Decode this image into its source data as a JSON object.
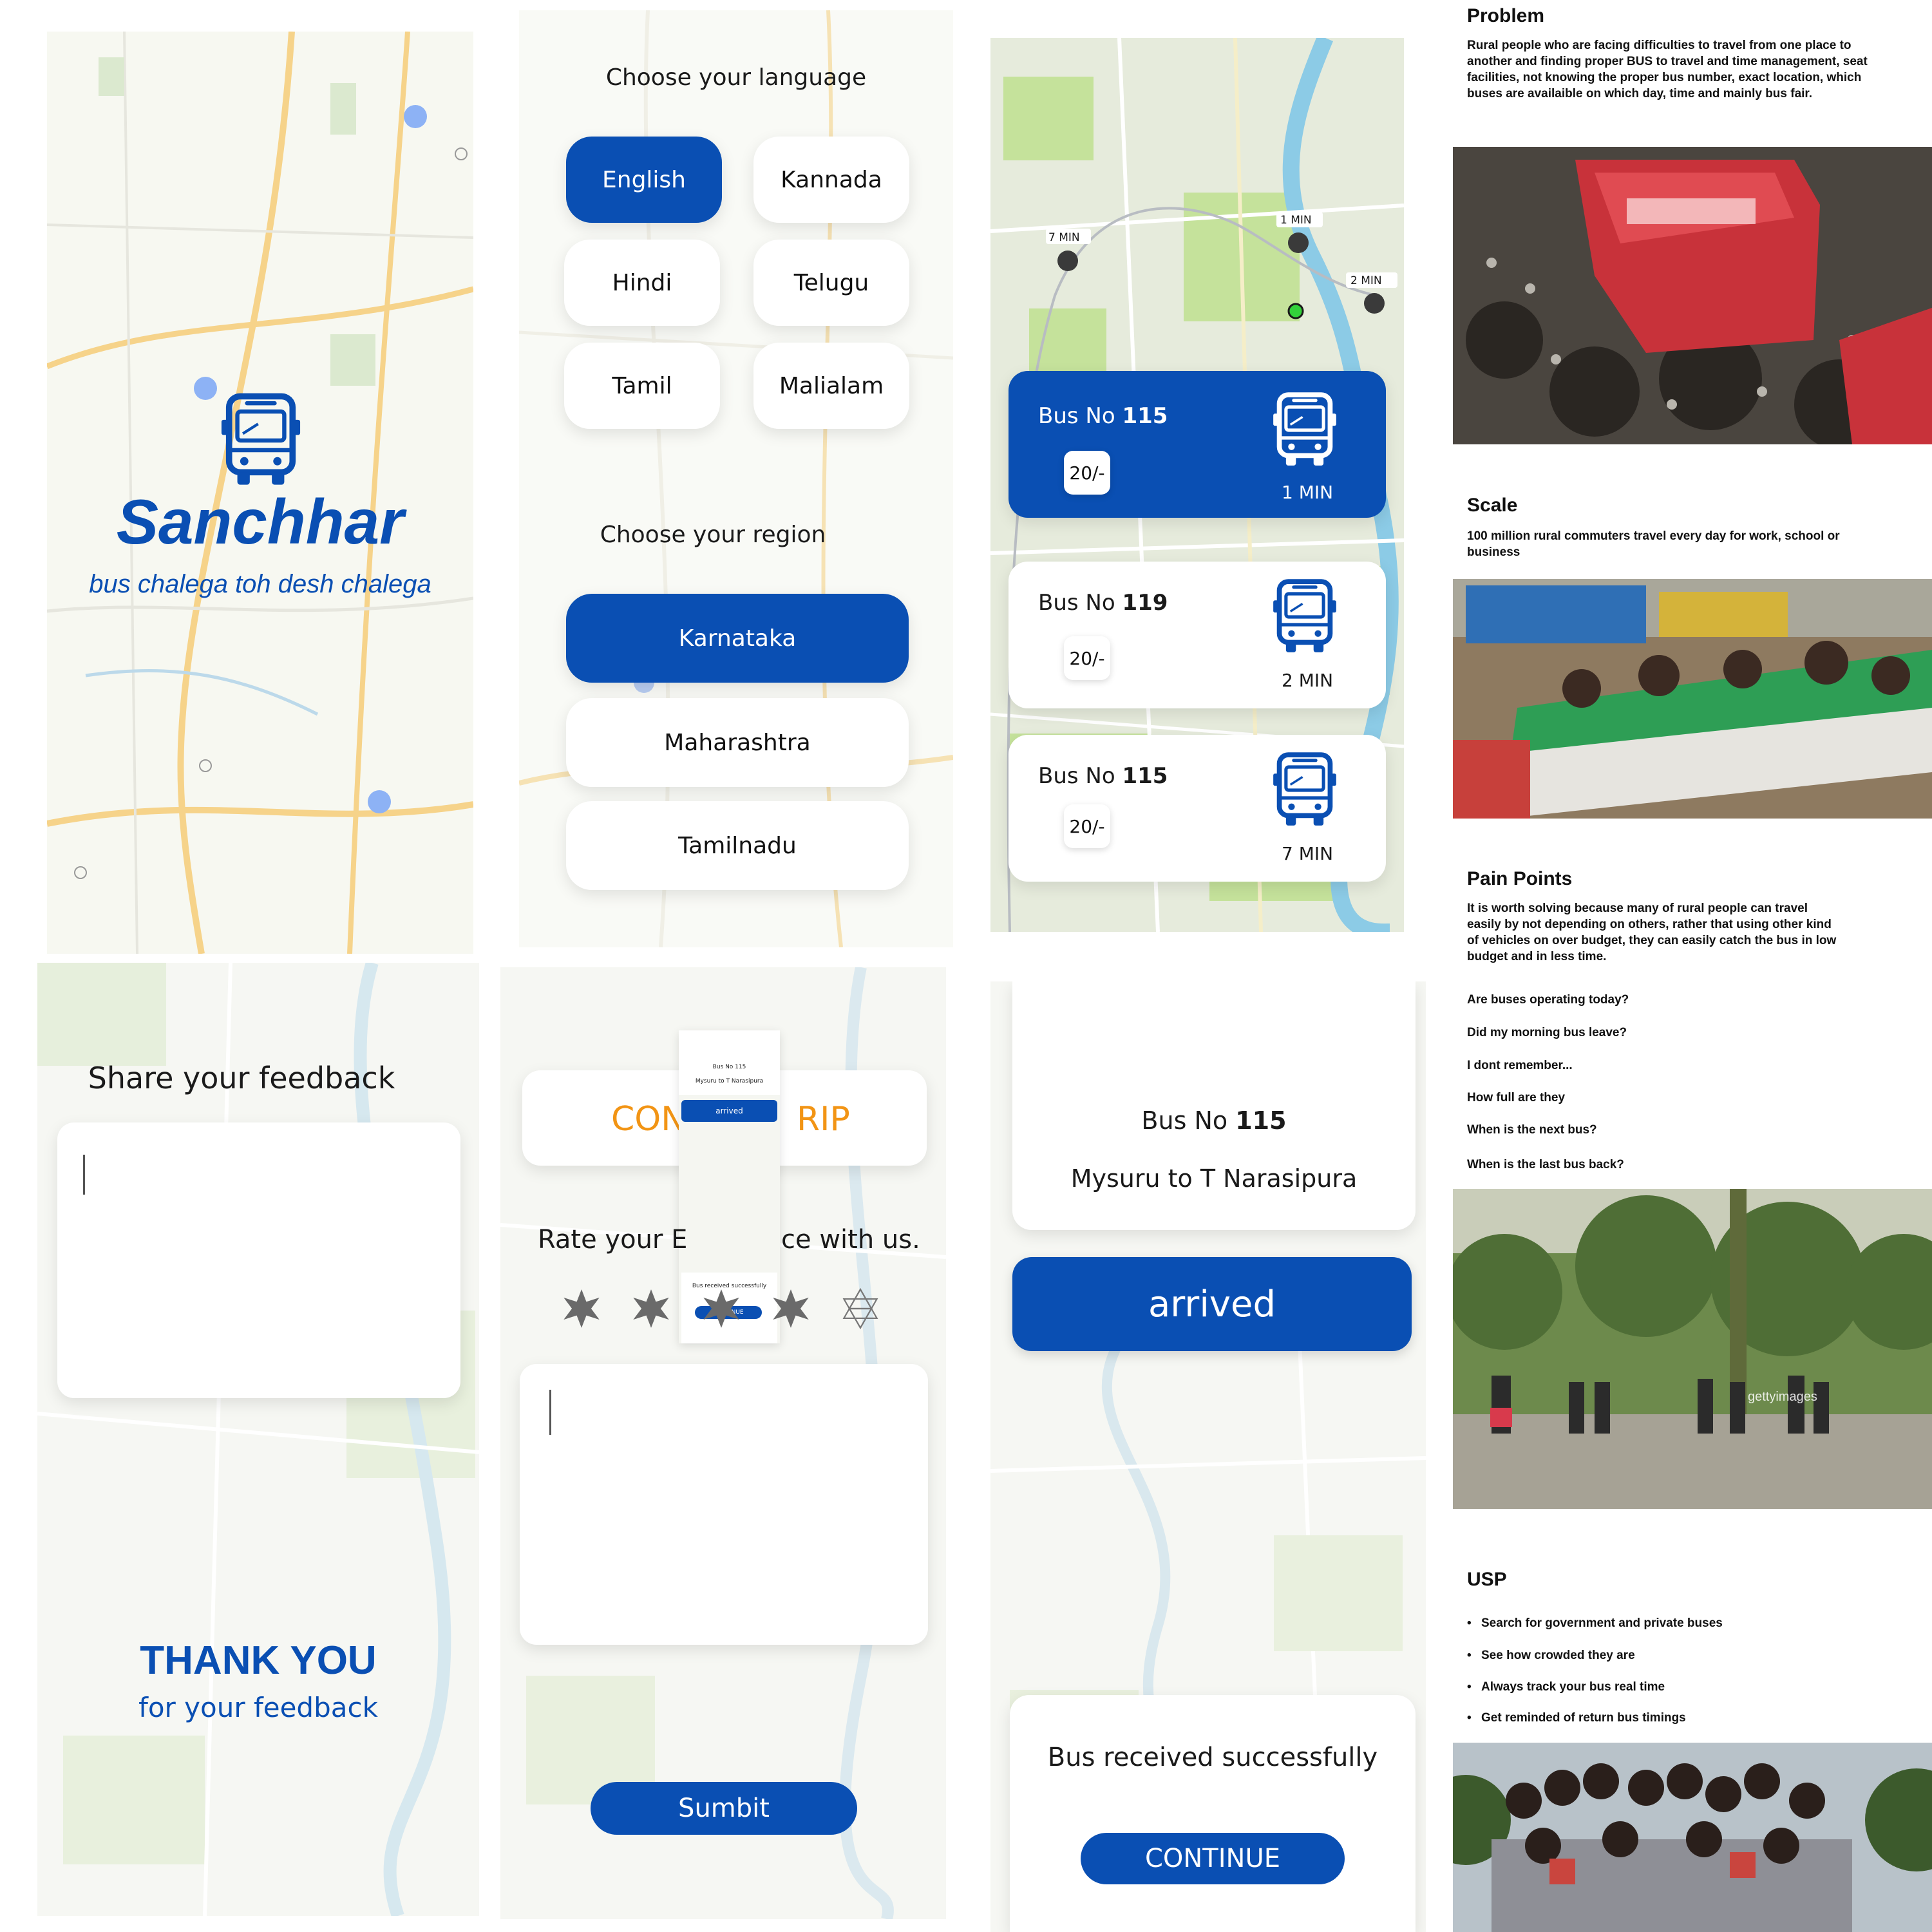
{
  "colors": {
    "brand": "#0a4fb3",
    "accent_orange": "#f29414",
    "map_bg": "#f7f8f1"
  },
  "splash": {
    "app_name": "Sanchhar",
    "tagline": "bus chalega toh desh chalega",
    "icon": "bus-icon"
  },
  "language": {
    "title": "Choose your language",
    "options": [
      "English",
      "Kannada",
      "Hindi",
      "Telugu",
      "Tamil",
      "Malialam"
    ],
    "selected": "English",
    "region_title": "Choose your region",
    "regions": [
      "Karnataka",
      "Maharashtra",
      "Tamilnadu"
    ],
    "selected_region": "Karnataka"
  },
  "bus_list": {
    "map_labels": [
      "7 MIN",
      "1 MIN",
      "2 MIN"
    ],
    "buses": [
      {
        "label": "Bus No",
        "number": "115",
        "fare": "20/-",
        "eta": "1 MIN",
        "selected": true
      },
      {
        "label": "Bus No",
        "number": "119",
        "fare": "20/-",
        "eta": "2 MIN",
        "selected": false
      },
      {
        "label": "Bus No",
        "number": "115",
        "fare": "20/-",
        "eta": "7 MIN",
        "selected": false
      }
    ]
  },
  "feedback": {
    "title": "Share your feedback",
    "thank_you": "THANK YOU",
    "thank_sub": "for your feedback"
  },
  "rating": {
    "banner_left": "CON",
    "banner_right": "RIP",
    "rate_left": "Rate your E",
    "rate_right": "ce with us.",
    "stars_filled": 4,
    "stars_total": 5,
    "submit": "Sumbit",
    "mini": {
      "bus_label": "Bus No 115",
      "route": "Mysuru to T Narasipura",
      "arrived": "arrived",
      "received": "Bus received successfully",
      "continue": "CONTINUE"
    }
  },
  "arrival": {
    "bus_label": "Bus No",
    "bus_number": "115",
    "route": "Mysuru to T Narasipura",
    "arrived": "arrived",
    "received": "Bus received successfully",
    "continue": "CONTINUE"
  },
  "research": {
    "problem_title": "Problem",
    "problem_text": "Rural people who are facing difficulties to travel from one place to another and finding proper BUS to travel and time management, seat facilities, not knowing the proper bus number, exact location, which buses are availaible on which day, time and mainly bus fair.",
    "scale_title": "Scale",
    "scale_text": "100 million rural commuters travel  every day for work, school or business",
    "pain_title": "Pain Points",
    "pain_text": "It is worth solving because many of rural people can travel easily by not depending on others, rather that using other kind of vehicles on over budget, they can easily catch the bus in low budget and in less time.",
    "questions": [
      "Are buses operating today?",
      "Did my morning bus leave?",
      "I dont remember...",
      "How full are they",
      "When is the next bus?",
      "When is the last bus back?"
    ],
    "watermark": "gettyimages",
    "usp_title": "USP",
    "usp_items": [
      "Search for government and private buses",
      "See how crowded they are",
      "Always track your bus real time",
      "Get reminded of return bus timings"
    ]
  }
}
